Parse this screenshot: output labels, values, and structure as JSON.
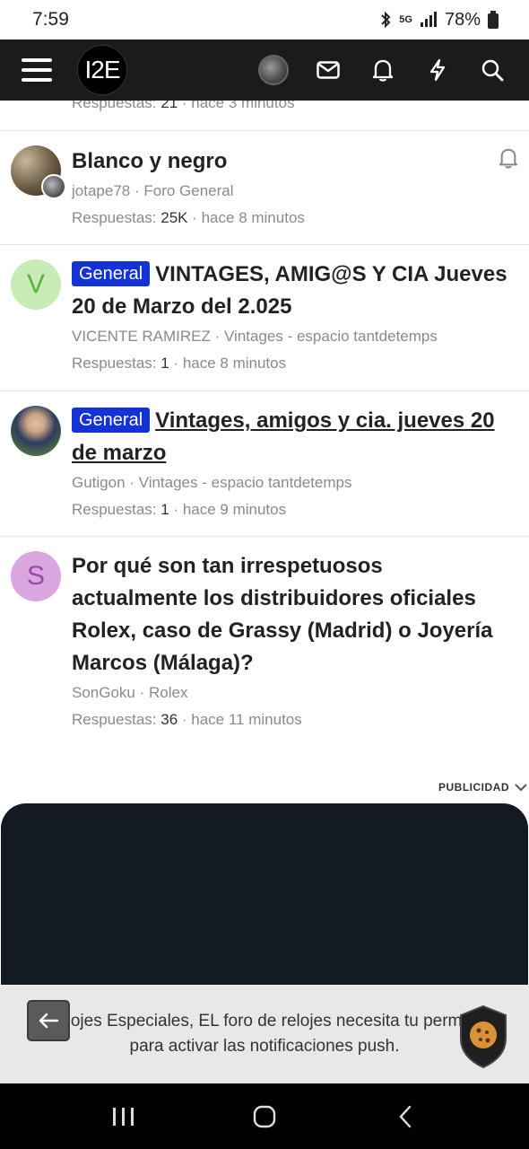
{
  "status": {
    "time": "7:59",
    "network": "5G",
    "battery": "78%"
  },
  "header": {
    "logo_text": "I2E",
    "icons": [
      "menu-icon",
      "avatar",
      "envelope-icon",
      "bell-icon",
      "lightning-icon",
      "search-icon"
    ]
  },
  "threads": {
    "partial": {
      "replies_label": "Respuestas:",
      "replies": "21",
      "time": "· hace 3 minutos"
    },
    "items": [
      {
        "title": "Blanco y negro",
        "author": "jotape78",
        "forum": "· Foro General",
        "replies_label": "Respuestas:",
        "replies": "25K",
        "time": "· hace 8 minutos"
      },
      {
        "avatar_letter": "V",
        "badge": "General",
        "title": "VINTAGES, AMIG@S Y CIA Jueves 20 de Marzo del 2.025",
        "author": "VICENTE RAMIREZ",
        "forum": "· Vintages - espacio tantdetemps",
        "replies_label": "Respuestas:",
        "replies": "1",
        "time": "· hace 8 minutos"
      },
      {
        "badge": "General",
        "title": "Vintages, amigos y cia. jueves 20 de marzo",
        "author": "Gutigon",
        "forum": "· Vintages - espacio tantdetemps",
        "replies_label": "Respuestas:",
        "replies": "1",
        "time": "· hace 9 minutos"
      },
      {
        "avatar_letter": "S",
        "title": "Por qué son tan irrespetuosos actualmente los distribuidores oficiales Rolex, caso de Grassy (Madrid) o Joyería Marcos (Málaga)?",
        "author": "SonGoku",
        "forum": "· Rolex",
        "replies_label": "Respuestas:",
        "replies": "36",
        "time": "· hace 11 minutos"
      }
    ]
  },
  "ad": {
    "label": "PUBLICIDAD"
  },
  "push_banner": {
    "text": "Relojes Especiales, EL foro de relojes necesita tu permiso para activar las notificaciones push."
  },
  "colors": {
    "header_bg": "#1b1b1b",
    "badge_bg": "#1433d6",
    "ad_bg": "#121a22"
  }
}
